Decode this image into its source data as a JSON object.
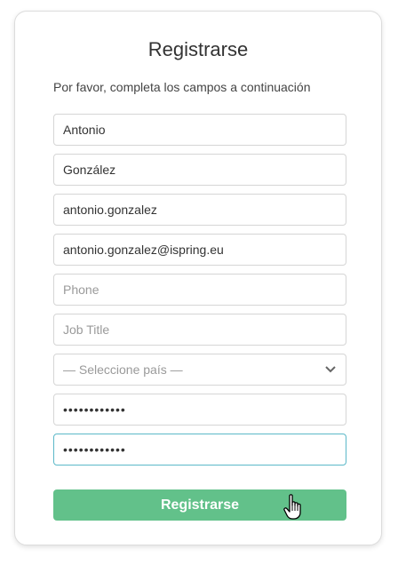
{
  "form": {
    "title": "Registrarse",
    "subtitle": "Por favor, completa los campos a continuación",
    "first_name": "Antonio",
    "last_name": "González",
    "username": "antonio.gonzalez",
    "email": "antonio.gonzalez@ispring.eu",
    "phone_placeholder": "Phone",
    "job_title_placeholder": "Job Title",
    "country_placeholder": "— Seleccione país —",
    "password_mask": "••••••••••••",
    "confirm_password_mask": "••••••••••••",
    "submit_label": "Registrarse"
  },
  "colors": {
    "submit_button": "#62c18a",
    "focus_border": "#5bb8c8"
  },
  "icons": {
    "select_arrow": "chevron-down-icon",
    "cursor": "hand-pointer-cursor-icon"
  }
}
